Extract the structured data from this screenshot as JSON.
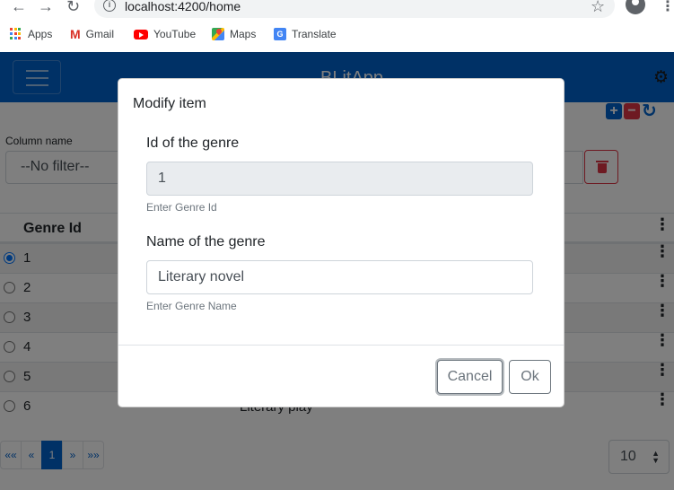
{
  "browser": {
    "url": "localhost:4200/home",
    "bookmarks": [
      "Apps",
      "Gmail",
      "YouTube",
      "Maps",
      "Translate"
    ]
  },
  "app": {
    "title": "BLitApp",
    "filter": {
      "label": "Column name",
      "value": "--No filter--"
    },
    "table": {
      "header": "Genre Id",
      "rows": [
        {
          "id": "1",
          "name": "",
          "selected": true
        },
        {
          "id": "2",
          "name": ""
        },
        {
          "id": "3",
          "name": ""
        },
        {
          "id": "4",
          "name": ""
        },
        {
          "id": "5",
          "name": ""
        },
        {
          "id": "6",
          "name": "Literary play"
        }
      ]
    },
    "pager": {
      "first": "««",
      "prev": "«",
      "current": "1",
      "next": "»",
      "last": "»»"
    },
    "page_size": "10"
  },
  "modal": {
    "title": "Modify item",
    "id_label": "Id of the genre",
    "id_value": "1",
    "id_help": "Enter Genre Id",
    "name_label": "Name of the genre",
    "name_value": "Literary novel",
    "name_help": "Enter Genre Name",
    "cancel_label": "Cancel",
    "ok_label": "Ok"
  },
  "colors": {
    "primary": "#0062cc",
    "danger": "#dc3545",
    "backdrop": "rgba(0,0,0,0.5)"
  }
}
